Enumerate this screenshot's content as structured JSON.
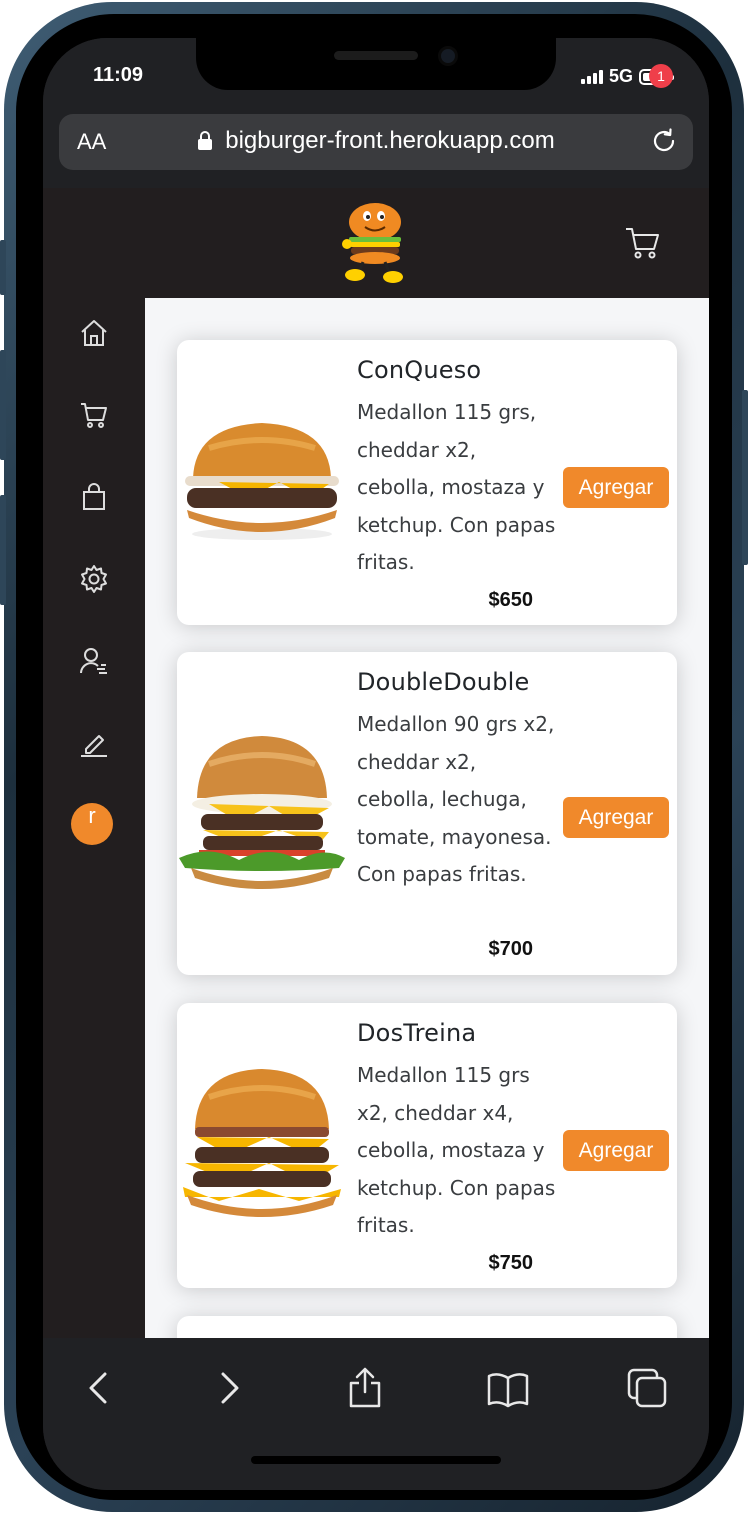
{
  "status_bar": {
    "time": "11:09",
    "network": "5G"
  },
  "browser": {
    "text_size_label": "AA",
    "url": "bigburger-front.herokuapp.com"
  },
  "header": {
    "cart_count": "1"
  },
  "sidebar": {
    "items": [
      {
        "icon": "home-icon"
      },
      {
        "icon": "cart-icon"
      },
      {
        "icon": "shopping-bag-icon"
      },
      {
        "icon": "gear-icon"
      },
      {
        "icon": "user-edit-icon"
      },
      {
        "icon": "pencil-icon"
      }
    ],
    "avatar_initial": "r"
  },
  "products": [
    {
      "name": "ConQueso",
      "description": "Medallon 115 grs, cheddar x2, cebolla, mostaza y ketchup. Con papas fritas.",
      "price": "$650",
      "button": "Agregar"
    },
    {
      "name": "DoubleDouble",
      "description": "Medallon 90 grs x2, cheddar x2, cebolla, lechuga, tomate, mayonesa. Con papas fritas.",
      "price": "$700",
      "button": "Agregar"
    },
    {
      "name": "DosTreina",
      "description": "Medallon 115 grs x2, cheddar x4, cebolla, mostaza y ketchup. Con papas fritas.",
      "price": "$750",
      "button": "Agregar"
    }
  ],
  "colors": {
    "accent": "#f0892b",
    "header_bg": "#221e1f",
    "badge": "#ef3f4a",
    "content_bg": "#f5f6f8"
  },
  "toolbar": {
    "items": [
      "back-icon",
      "forward-icon",
      "share-icon",
      "bookmarks-icon",
      "tabs-icon"
    ]
  }
}
